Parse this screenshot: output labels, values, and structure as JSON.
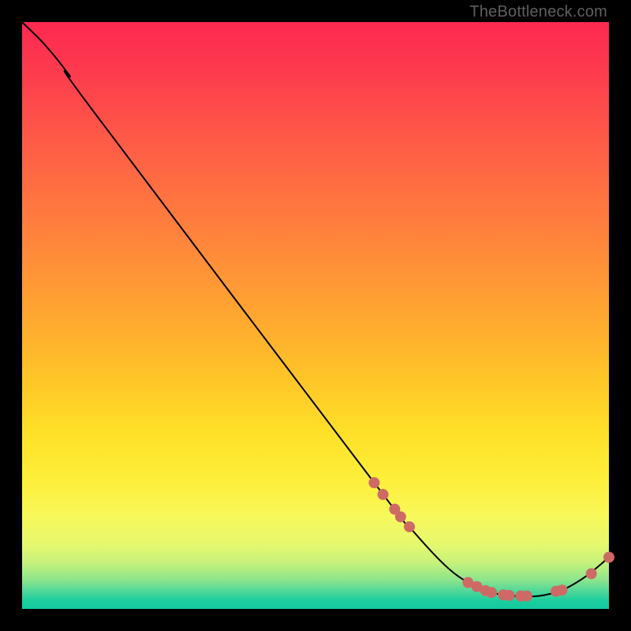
{
  "watermark": "TheBottleneck.com",
  "chart_data": {
    "type": "line",
    "title": "",
    "xlabel": "",
    "ylabel": "",
    "xlim": [
      0,
      100
    ],
    "ylim": [
      0,
      100
    ],
    "series": [
      {
        "name": "curve",
        "stroke": "#000000",
        "stroke_width": 2,
        "points": [
          {
            "x": 0,
            "y": 100
          },
          {
            "x": 4,
            "y": 96
          },
          {
            "x": 8,
            "y": 91
          },
          {
            "x": 12,
            "y": 85
          },
          {
            "x": 60,
            "y": 21.5
          },
          {
            "x": 66,
            "y": 14
          },
          {
            "x": 72,
            "y": 7.5
          },
          {
            "x": 76,
            "y": 4.5
          },
          {
            "x": 80,
            "y": 2.8
          },
          {
            "x": 84,
            "y": 2.2
          },
          {
            "x": 88,
            "y": 2.2
          },
          {
            "x": 92,
            "y": 3.2
          },
          {
            "x": 96,
            "y": 5.5
          },
          {
            "x": 100,
            "y": 8.8
          }
        ]
      }
    ],
    "markers": {
      "name": "highlight-points",
      "fill": "#cd6a66",
      "radius": 7,
      "points": [
        {
          "x": 60.0,
          "y": 21.5
        },
        {
          "x": 61.5,
          "y": 19.5
        },
        {
          "x": 63.5,
          "y": 17.0
        },
        {
          "x": 64.5,
          "y": 15.7
        },
        {
          "x": 66.0,
          "y": 14.0
        },
        {
          "x": 76.0,
          "y": 4.5
        },
        {
          "x": 77.5,
          "y": 3.8
        },
        {
          "x": 79.0,
          "y": 3.1
        },
        {
          "x": 80.0,
          "y": 2.8
        },
        {
          "x": 82.0,
          "y": 2.4
        },
        {
          "x": 83.0,
          "y": 2.3
        },
        {
          "x": 85.0,
          "y": 2.2
        },
        {
          "x": 86.0,
          "y": 2.2
        },
        {
          "x": 91.0,
          "y": 3.0
        },
        {
          "x": 92.0,
          "y": 3.2
        },
        {
          "x": 97.0,
          "y": 6.0
        },
        {
          "x": 100.0,
          "y": 8.8
        }
      ]
    },
    "background_gradient": {
      "direction": "top-to-bottom",
      "stops": [
        {
          "pos": 0,
          "color": "#fd2850"
        },
        {
          "pos": 50,
          "color": "#ffb030"
        },
        {
          "pos": 80,
          "color": "#fcf050"
        },
        {
          "pos": 100,
          "color": "#11c9a1"
        }
      ]
    }
  }
}
